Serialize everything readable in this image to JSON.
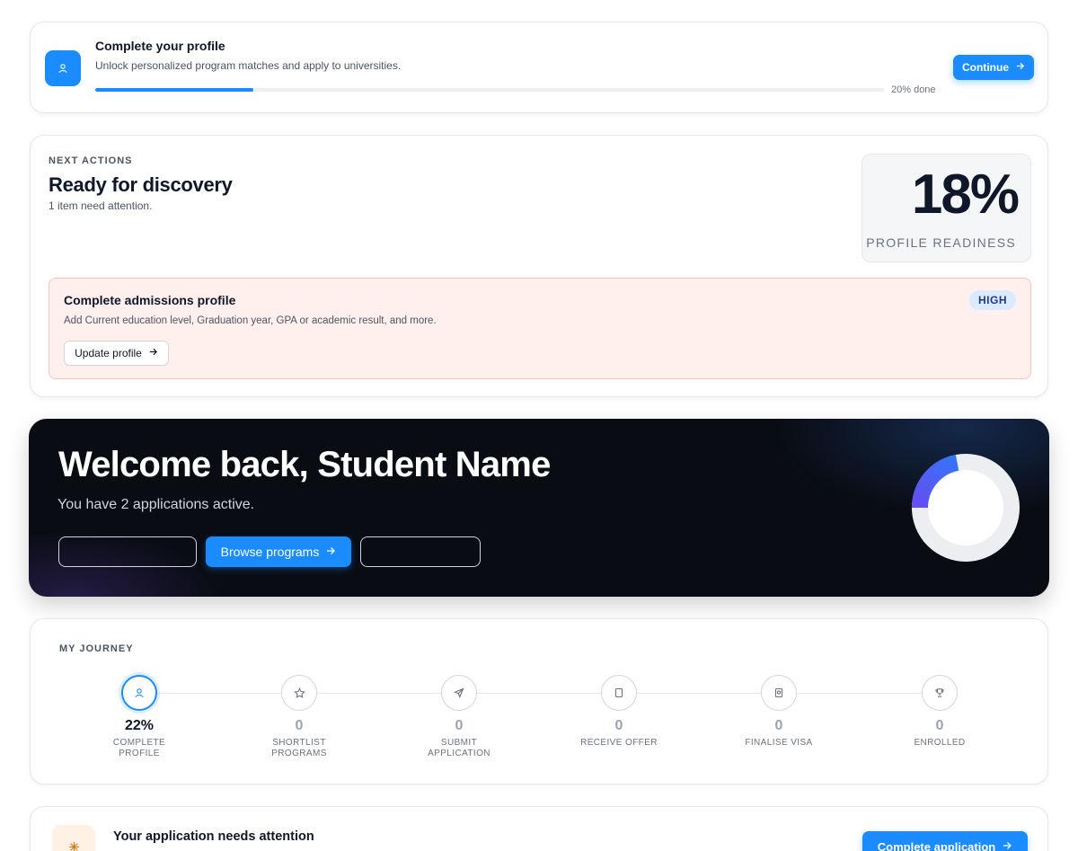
{
  "colors": {
    "accent": "#1a8cff",
    "hero_background": "#090c13",
    "alert_background": "#fff0ee",
    "badge_background": "#dbeafe",
    "ring_gradient_start": "#1a8cff",
    "ring_gradient_end": "#7c3aed"
  },
  "profile_prompt": {
    "title": "Complete your profile",
    "subtitle": "Unlock personalized program matches and apply to universities.",
    "progress_percent": 20,
    "progress_label": "20% done",
    "button_label": "Continue",
    "icon": "user-icon"
  },
  "next_actions": {
    "eyebrow": "NEXT ACTIONS",
    "title": "Ready for discovery",
    "subtitle": "1 item need attention.",
    "readiness_value": "18%",
    "readiness_label": "PROFILE READINESS",
    "alert": {
      "title": "Complete admissions profile",
      "description": "Add Current education level, Graduation year, GPA or academic result, and more.",
      "badge": "HIGH",
      "button_label": "Update profile"
    }
  },
  "hero": {
    "title": "Welcome back, Student Name",
    "subtitle": "You have 2 applications active.",
    "ghost_button_1": "",
    "browse_button": "Browse programs",
    "ghost_button_2": "",
    "ring_progress": 0.22
  },
  "journey": {
    "eyebrow": "MY JOURNEY",
    "steps": [
      {
        "value": "22%",
        "label": "COMPLETE PROFILE",
        "icon": "user-icon",
        "active": true
      },
      {
        "value": "0",
        "label": "SHORTLIST PROGRAMS",
        "icon": "star-icon",
        "active": false
      },
      {
        "value": "0",
        "label": "SUBMIT APPLICATION",
        "icon": "send-icon",
        "active": false
      },
      {
        "value": "0",
        "label": "RECEIVE OFFER",
        "icon": "document-icon",
        "active": false
      },
      {
        "value": "0",
        "label": "FINALISE VISA",
        "icon": "passport-icon",
        "active": false
      },
      {
        "value": "0",
        "label": "ENROLLED",
        "icon": "trophy-icon",
        "active": false
      }
    ]
  },
  "attention": {
    "title": "Your application needs attention",
    "button_label": "Complete application",
    "icon": "sparkle-icon"
  }
}
